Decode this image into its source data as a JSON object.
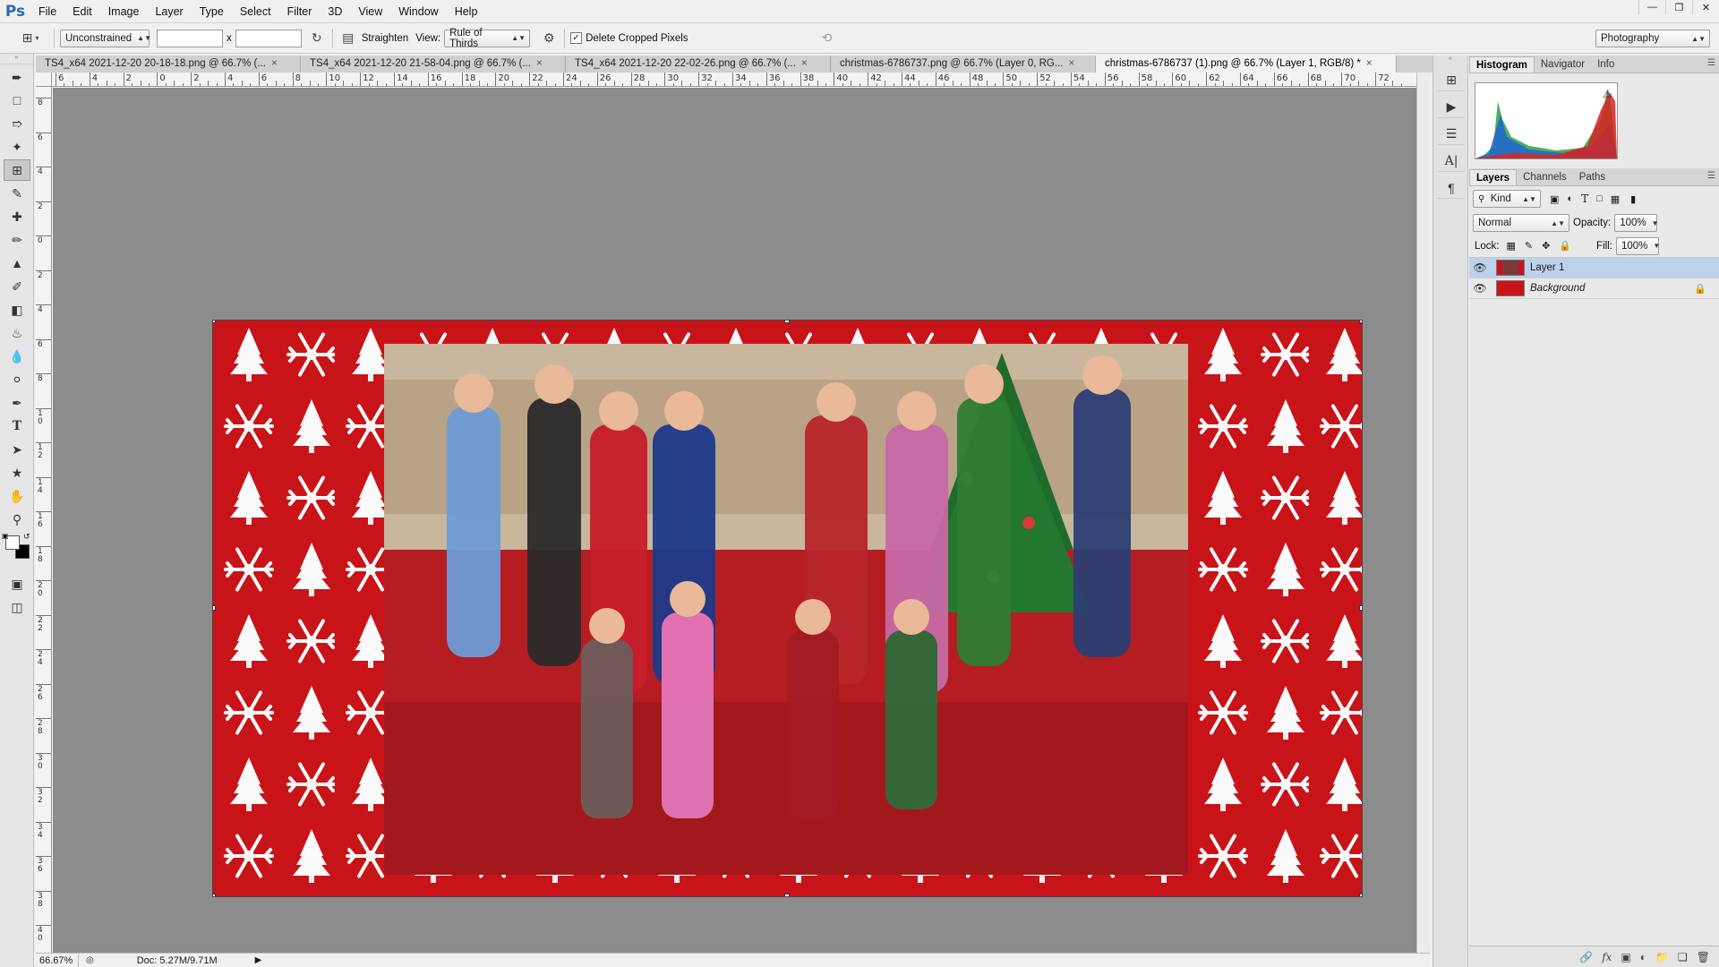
{
  "app": {
    "logo": "Ps",
    "menu": [
      "File",
      "Edit",
      "Image",
      "Layer",
      "Type",
      "Select",
      "Filter",
      "3D",
      "View",
      "Window",
      "Help"
    ]
  },
  "options": {
    "ratio_value": "Unconstrained",
    "ratio_width": "",
    "ratio_height": "",
    "ratio_sep": "x",
    "straighten_label": "Straighten",
    "view_label": "View:",
    "view_value": "Rule of Thirds",
    "delete_cropped_label": "Delete Cropped Pixels",
    "delete_cropped_checked": true,
    "workspace": "Photography"
  },
  "tabs": [
    {
      "label": "TS4_x64 2021-12-20 20-18-18.png @ 66.7% (...",
      "active": false
    },
    {
      "label": "TS4_x64 2021-12-20 21-58-04.png @ 66.7% (...",
      "active": false
    },
    {
      "label": "TS4_x64 2021-12-20 22-02-26.png @ 66.7% (...",
      "active": false
    },
    {
      "label": "christmas-6786737.png @ 66.7% (Layer 0, RG...",
      "active": false
    },
    {
      "label": "christmas-6786737 (1).png @ 66.7% (Layer 1, RGB/8) *",
      "active": true
    }
  ],
  "ruler": {
    "h_labels": [
      "6",
      "4",
      "2",
      "0",
      "2",
      "4",
      "6",
      "8",
      "10",
      "12",
      "14",
      "16",
      "18",
      "20",
      "22",
      "24",
      "26",
      "28",
      "30",
      "32",
      "34",
      "36",
      "38",
      "40",
      "42",
      "44",
      "46",
      "48",
      "50",
      "52",
      "54",
      "56",
      "58",
      "60",
      "62",
      "64",
      "66",
      "68",
      "70",
      "72"
    ],
    "v_labels": [
      "8",
      "6",
      "4",
      "2",
      "0",
      "2",
      "4",
      "6",
      "8",
      "10",
      "12",
      "14",
      "16",
      "18",
      "20",
      "22",
      "24",
      "26",
      "28",
      "30",
      "32",
      "34",
      "36",
      "38",
      "40"
    ]
  },
  "status": {
    "zoom": "66.67%",
    "doc_info": "Doc: 5.27M/9.71M"
  },
  "histogram_tabs": [
    "Histogram",
    "Navigator",
    "Info"
  ],
  "layers_panel": {
    "tabs": [
      "Layers",
      "Channels",
      "Paths"
    ],
    "kind_label": "Kind",
    "blend_mode": "Normal",
    "opacity_label": "Opacity:",
    "opacity_value": "100%",
    "lock_label": "Lock:",
    "fill_label": "Fill:",
    "fill_value": "100%",
    "layers": [
      {
        "name": "Layer 1",
        "selected": true,
        "locked": false
      },
      {
        "name": "Background",
        "selected": false,
        "locked": true
      }
    ]
  },
  "colors": {
    "canvas_red": "#c81418",
    "selection_blue": "#bcd1ec",
    "workspace_gray": "#8c8c8c"
  }
}
